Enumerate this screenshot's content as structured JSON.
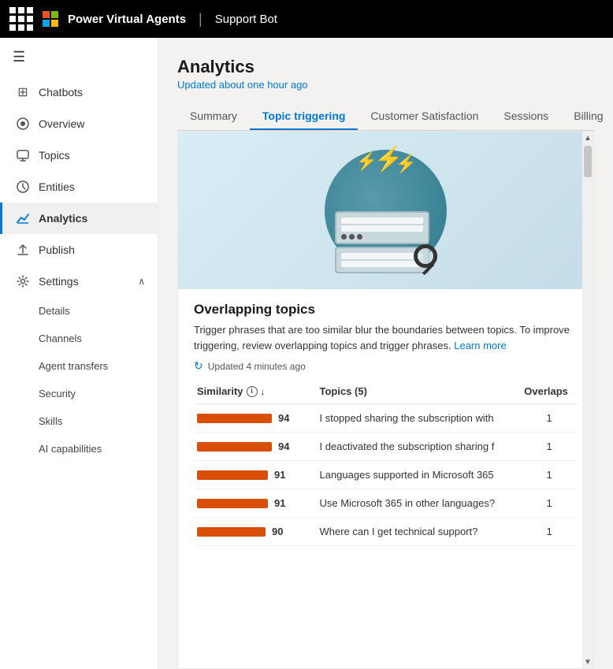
{
  "topNav": {
    "appName": "Power Virtual Agents",
    "separator": "|",
    "botName": "Support Bot"
  },
  "sidebar": {
    "hamburger": "☰",
    "items": [
      {
        "id": "chatbots",
        "label": "Chatbots",
        "icon": "⊞"
      },
      {
        "id": "overview",
        "label": "Overview",
        "icon": "⊙"
      },
      {
        "id": "topics",
        "label": "Topics",
        "icon": "💬"
      },
      {
        "id": "entities",
        "label": "Entities",
        "icon": "⊕"
      },
      {
        "id": "analytics",
        "label": "Analytics",
        "icon": "📈",
        "active": true
      },
      {
        "id": "publish",
        "label": "Publish",
        "icon": "↑"
      },
      {
        "id": "settings",
        "label": "Settings",
        "icon": "⚙",
        "expanded": true
      }
    ],
    "settingsSubItems": [
      {
        "id": "details",
        "label": "Details"
      },
      {
        "id": "channels",
        "label": "Channels"
      },
      {
        "id": "agent-transfers",
        "label": "Agent transfers"
      },
      {
        "id": "security",
        "label": "Security"
      },
      {
        "id": "skills",
        "label": "Skills"
      },
      {
        "id": "ai-capabilities",
        "label": "AI capabilities"
      }
    ]
  },
  "page": {
    "title": "Analytics",
    "subtitle": "Updated about one hour ago"
  },
  "tabs": [
    {
      "id": "summary",
      "label": "Summary"
    },
    {
      "id": "topic-triggering",
      "label": "Topic triggering",
      "active": true
    },
    {
      "id": "customer-satisfaction",
      "label": "Customer Satisfaction"
    },
    {
      "id": "sessions",
      "label": "Sessions"
    },
    {
      "id": "billing",
      "label": "Billing"
    }
  ],
  "overlappingTopics": {
    "title": "Overlapping topics",
    "description": "Trigger phrases that are too similar blur the boundaries between topics. To improve triggering, review overlapping topics and trigger phrases.",
    "learnMoreText": "Learn more",
    "updatedText": "Updated 4 minutes ago",
    "tableHeaders": {
      "similarity": "Similarity",
      "topics": "Topics (5)",
      "overlaps": "Overlaps"
    },
    "rows": [
      {
        "similarity": 94,
        "barWidth": 95,
        "topic": "I stopped sharing the subscription with",
        "overlaps": 1
      },
      {
        "similarity": 94,
        "barWidth": 95,
        "topic": "I deactivated the subscription sharing f",
        "overlaps": 1
      },
      {
        "similarity": 91,
        "barWidth": 90,
        "topic": "Languages supported in Microsoft 365",
        "overlaps": 1
      },
      {
        "similarity": 91,
        "barWidth": 90,
        "topic": "Use Microsoft 365 in other languages?",
        "overlaps": 1
      },
      {
        "similarity": 90,
        "barWidth": 87,
        "topic": "Where can I get technical support?",
        "overlaps": 1
      }
    ]
  }
}
